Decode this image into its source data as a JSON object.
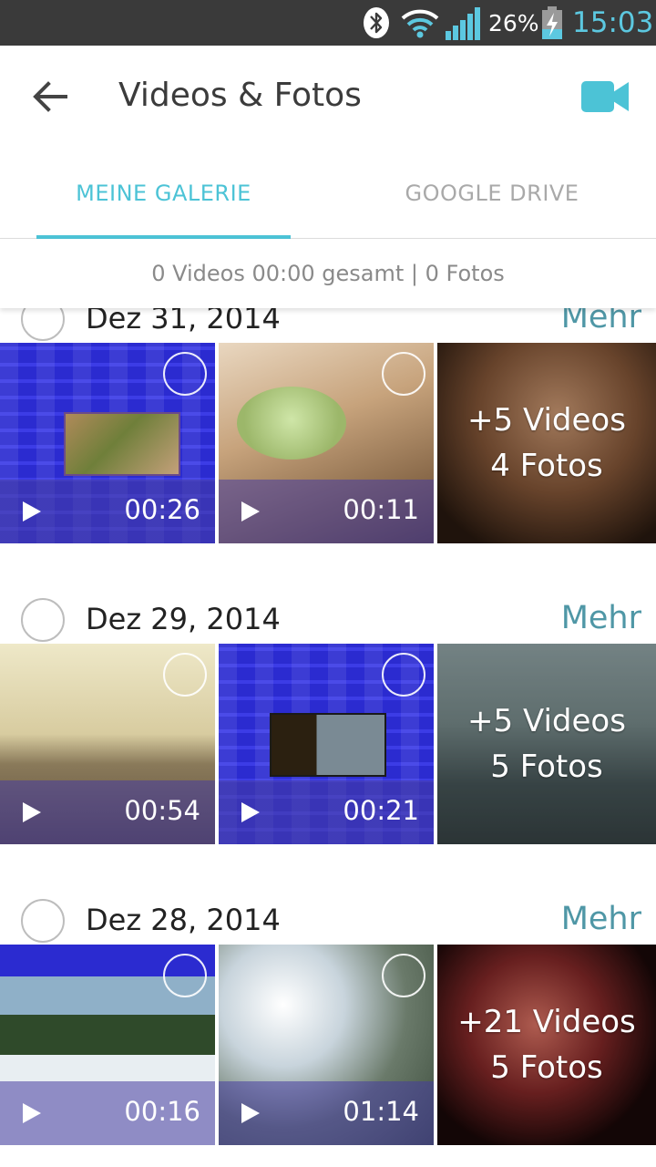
{
  "status_bar": {
    "battery_percent": "26%",
    "time": "15:03",
    "icons": [
      "bluetooth-icon",
      "wifi-icon",
      "signal-icon",
      "battery-charging-icon"
    ]
  },
  "header": {
    "title": "Videos & Fotos",
    "back_icon": "arrow-left-icon",
    "camera_icon": "video-camera-icon",
    "accent_color": "#4cc3d6"
  },
  "tabs": [
    {
      "label": "MEINE GALERIE",
      "active": true
    },
    {
      "label": "GOOGLE DRIVE",
      "active": false
    }
  ],
  "summary": "0 Videos 00:00 gesamt | 0 Fotos",
  "groups": [
    {
      "date": "Dez 31, 2014",
      "more": "Mehr",
      "items": [
        {
          "duration": "00:26"
        },
        {
          "duration": "00:11"
        }
      ],
      "overflow": {
        "videos": "+5 Videos",
        "photos": "4 Fotos"
      }
    },
    {
      "date": "Dez 29, 2014",
      "more": "Mehr",
      "items": [
        {
          "duration": "00:54"
        },
        {
          "duration": "00:21"
        }
      ],
      "overflow": {
        "videos": "+5 Videos",
        "photos": "5 Fotos"
      }
    },
    {
      "date": "Dez 28, 2014",
      "more": "Mehr",
      "items": [
        {
          "duration": "00:16"
        },
        {
          "duration": "01:14"
        }
      ],
      "overflow": {
        "videos": "+21 Videos",
        "photos": "5 Fotos"
      }
    }
  ]
}
